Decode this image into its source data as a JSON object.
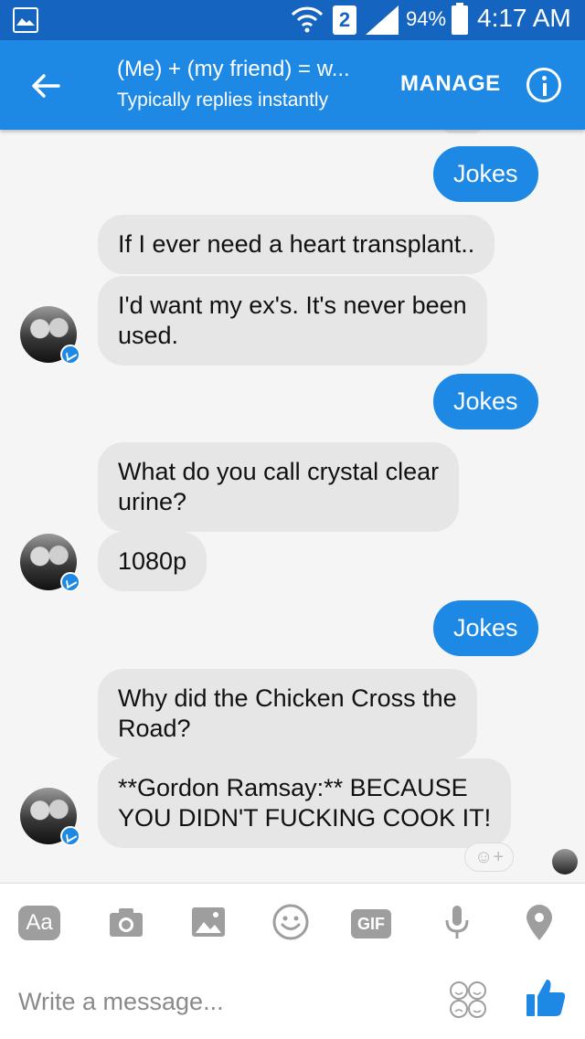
{
  "status_bar": {
    "sim_slot": "2",
    "battery": "94%",
    "time": "4:17 AM"
  },
  "header": {
    "title": "(Me) + (my friend) = w...",
    "subtitle": "Typically replies instantly",
    "manage_label": "MANAGE"
  },
  "messages": [
    {
      "dir": "out",
      "text": "Jokes"
    },
    {
      "dir": "in",
      "text": "If I ever need a heart transplant.."
    },
    {
      "dir": "in",
      "text": "I'd want my ex's. It's never been\nused."
    },
    {
      "dir": "out",
      "text": "Jokes"
    },
    {
      "dir": "in",
      "text": "What do you call crystal clear\nurine?"
    },
    {
      "dir": "in",
      "text": "1080p"
    },
    {
      "dir": "out",
      "text": "Jokes"
    },
    {
      "dir": "in",
      "text": "Why did the Chicken Cross the\nRoad?"
    },
    {
      "dir": "in",
      "text": "**Gordon Ramsay:** BECAUSE\nYOU DIDN'T FUCKING COOK IT!"
    }
  ],
  "toolbar": {
    "text_button": "Aa",
    "gif_button": "GIF"
  },
  "composer": {
    "placeholder": "Write a message..."
  },
  "icons": [
    "gallery-icon",
    "wifi-icon",
    "signal-icon",
    "battery-icon",
    "back-arrow-icon",
    "info-icon",
    "camera-icon",
    "image-icon",
    "emoji-icon",
    "microphone-icon",
    "location-icon",
    "stickers-icon",
    "like-icon",
    "add-reaction-icon"
  ],
  "colors": {
    "status_bar": "#1565c0",
    "header": "#1e88e5",
    "outgoing_bubble": "#1e88e5",
    "incoming_bubble": "#e6e6e6",
    "icon_gray": "#9e9e9e"
  }
}
